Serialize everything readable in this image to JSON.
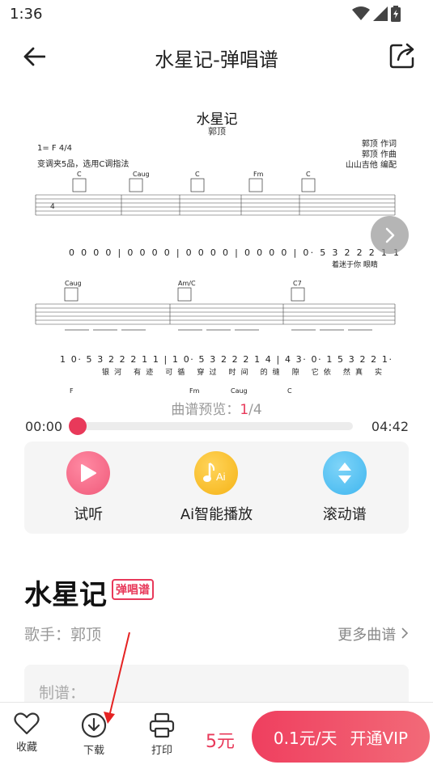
{
  "status_bar": {
    "time": "1:36",
    "icons": [
      "wifi-icon",
      "signal-icon",
      "battery-icon"
    ]
  },
  "header": {
    "title": "水星记-弹唱谱",
    "back_icon": "back-arrow-icon",
    "share_icon": "share-icon"
  },
  "sheet": {
    "title": "水星记",
    "artist": "郭顶",
    "key": "1= F 4/4",
    "capo_note": "变调夹5品，选用C调指法",
    "credits": [
      "郭顶 作词",
      "郭顶 作曲",
      "山山吉他 编配"
    ],
    "chords_row1": [
      "C",
      "Caug",
      "C",
      "Fm",
      "C"
    ],
    "chords_row2": [
      "Caug",
      "Am/C",
      "C7"
    ],
    "chords_row3": [
      "F",
      "Fm",
      "Caug",
      "C"
    ],
    "numbers_row1": "0 0 0 0 | 0 0 0 0 | 0 0 0 0 | 0 0 0 0 | 0· 5 3 2 2 2 1 1",
    "lyrics_row1": "着迷于你  眼睛",
    "numbers_row2": "1  0· 5 3 2 2 2 1 1 | 1  0· 5 3 2 2 2 1 4 | 4 3· 0· 1 5 3 2 2 1·",
    "lyrics_row2": "银河 有迹  可循    穿过 时间  的缝  隙   它依 然真  实"
  },
  "preview": {
    "label": "曲谱预览：",
    "current": "1",
    "total": "/4"
  },
  "player": {
    "current_time": "00:00",
    "duration": "04:42",
    "progress": 0.0
  },
  "features": [
    {
      "label": "试听",
      "icon": "play-icon",
      "color": "#f05a7a"
    },
    {
      "label": "Ai智能播放",
      "icon": "ai-music-note-icon",
      "color": "#f5b316"
    },
    {
      "label": "滚动谱",
      "icon": "scroll-updown-icon",
      "color": "#3fb6ef"
    }
  ],
  "song": {
    "title": "水星记",
    "badge": "弹唱谱",
    "singer": "歌手：郭顶",
    "more": "更多曲谱"
  },
  "maker": {
    "label": "制谱："
  },
  "bottom_bar": {
    "favorite": "收藏",
    "download": "下载",
    "print": "打印",
    "price": "5元",
    "vip_price": "0.1元/天",
    "vip_label": "开通VIP"
  },
  "colors": {
    "accent": "#e8395a",
    "muted": "#999999",
    "panel": "#f5f5f5"
  }
}
